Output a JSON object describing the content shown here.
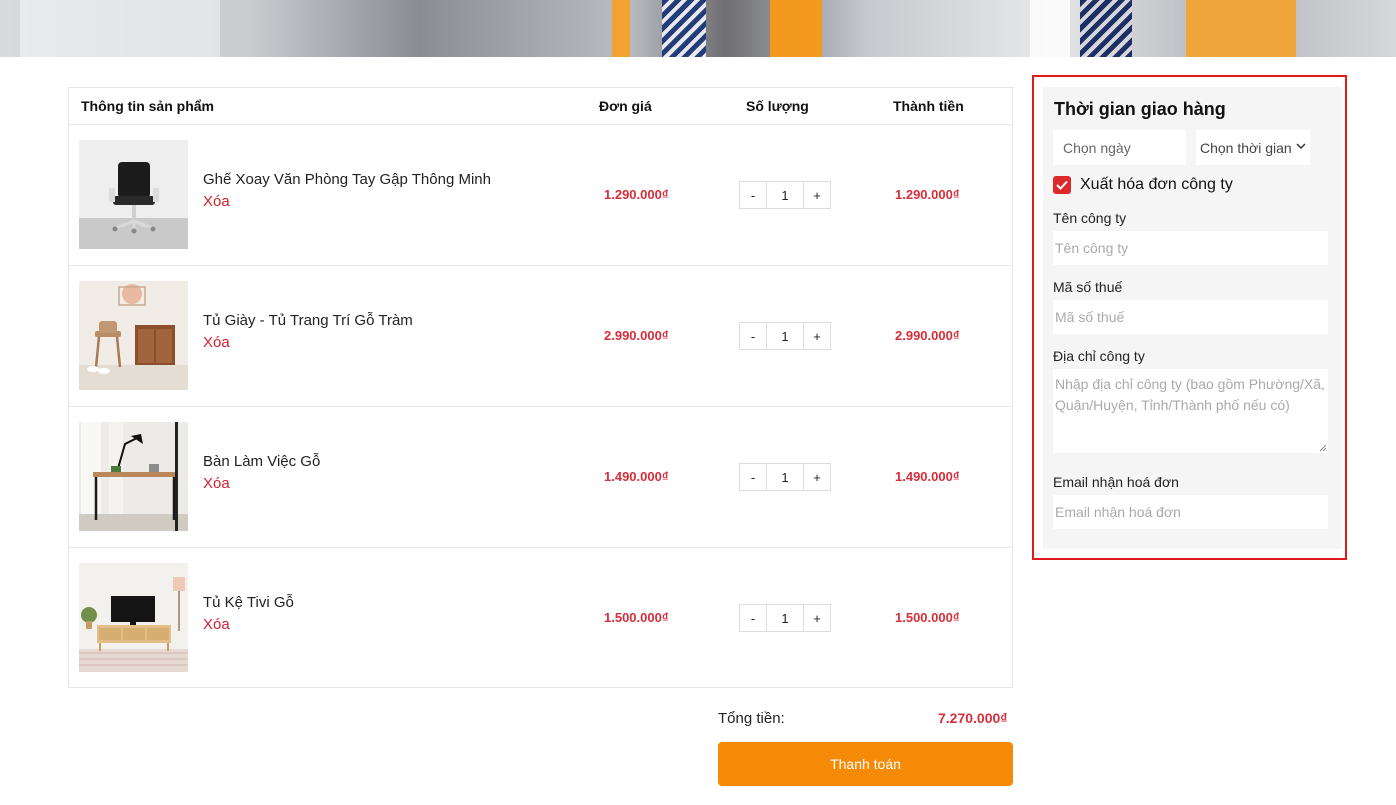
{
  "cart": {
    "headers": {
      "product_info": "Thông tin sản phẩm",
      "unit_price": "Đơn giá",
      "quantity": "Số lượng",
      "line_total": "Thành tiền"
    },
    "remove_label": "Xóa",
    "minus_label": "-",
    "plus_label": "+",
    "items": [
      {
        "name": "Ghế Xoay Văn Phòng Tay Gập Thông Minh",
        "price": "1.290.000₫",
        "quantity": "1",
        "total": "1.290.000₫",
        "image": "office-chair"
      },
      {
        "name": "Tủ Giày - Tủ Trang Trí Gỗ Tràm",
        "price": "2.990.000₫",
        "quantity": "1",
        "total": "2.990.000₫",
        "image": "shoe-cabinet"
      },
      {
        "name": "Bàn Làm Việc Gỗ",
        "price": "1.490.000₫",
        "quantity": "1",
        "total": "1.490.000₫",
        "image": "wooden-desk"
      },
      {
        "name": "Tủ Kệ Tivi Gỗ",
        "price": "1.500.000₫",
        "quantity": "1",
        "total": "1.500.000₫",
        "image": "tv-cabinet"
      }
    ],
    "total_label": "Tổng tiền:",
    "total_value": "7.270.000₫",
    "checkout_label": "Thanh toán"
  },
  "delivery": {
    "title": "Thời gian giao hàng",
    "date_select": "Chọn ngày",
    "time_select": "Chọn thời gian",
    "invoice_checkbox": {
      "label": "Xuất hóa đơn công ty",
      "checked": true
    },
    "company_name": {
      "label": "Tên công ty",
      "placeholder": "Tên công ty"
    },
    "tax_code": {
      "label": "Mã số thuế",
      "placeholder": "Mã số thuế"
    },
    "company_address": {
      "label": "Địa chỉ công ty",
      "placeholder": "Nhập địa chỉ công ty (bao gồm Phường/Xã, Quận/Huyện, Tỉnh/Thành phố nếu có)"
    },
    "invoice_email": {
      "label": "Email nhận hoá đơn",
      "placeholder": "Email nhận hoá đơn"
    }
  },
  "colors": {
    "price_red": "#d62e3a",
    "remove_red": "#d1222f",
    "checkout_orange": "#f58a07",
    "highlight_border": "#e01a1a",
    "panel_bg": "#f5f5f5"
  }
}
